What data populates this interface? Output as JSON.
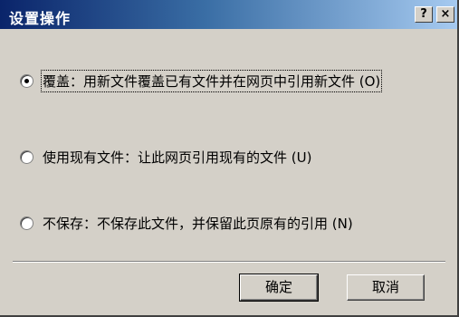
{
  "dialog": {
    "title": "设置操作",
    "help_label": "?",
    "close_label": "×"
  },
  "options": [
    {
      "label": "覆盖：用新文件覆盖已有文件并在网页中引用新文件 (O)",
      "selected": true
    },
    {
      "label": "使用现有文件：让此网页引用现有的文件 (U)",
      "selected": false
    },
    {
      "label": "不保存：不保存此文件，并保留此页原有的引用 (N)",
      "selected": false
    }
  ],
  "buttons": {
    "ok_label": "确定",
    "cancel_label": "取消"
  }
}
